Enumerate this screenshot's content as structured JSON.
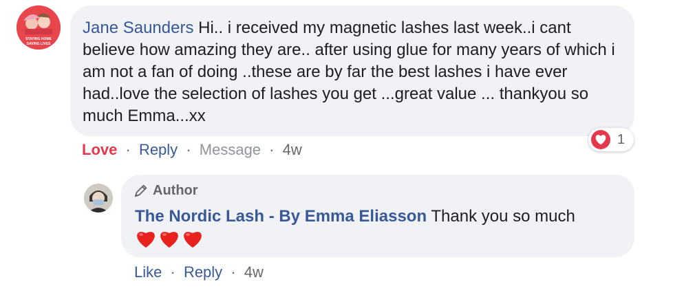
{
  "comment": {
    "author": "Jane Saunders",
    "text": " Hi.. i received my magnetic lashes last week..i cant believe how amazing they are.. after using glue for many years of which i am not a fan of doing ..these are by far the best lashes i have ever had..love the selection of lashes you get ...great value ... thankyou so much Emma...xx",
    "avatar_caption": "STAYING HOME SAVING LIVES",
    "actions": {
      "love": "Love",
      "reply": "Reply",
      "message": "Message",
      "time": "4w"
    },
    "reaction": {
      "icon": "heart-icon",
      "count": "1"
    }
  },
  "reply": {
    "badge": "Author",
    "author": "The Nordic Lash - By Emma Eliasson",
    "text": " Thank you so much",
    "emojis": [
      "heart-emoji",
      "heart-emoji",
      "heart-emoji"
    ],
    "actions": {
      "like": "Like",
      "reply": "Reply",
      "time": "4w"
    }
  },
  "colors": {
    "link": "#385898",
    "love": "#e4384d",
    "bubble": "#f0f2f5",
    "muted": "#65676b"
  }
}
